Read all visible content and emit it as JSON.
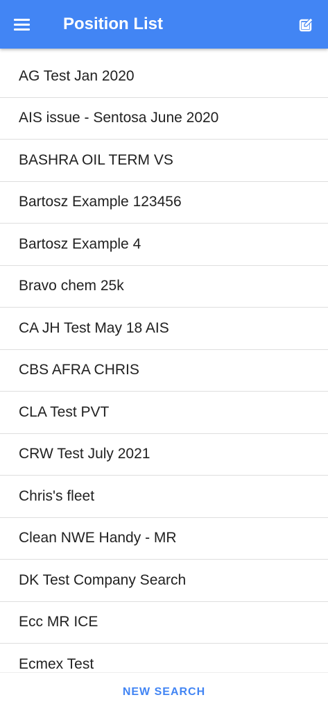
{
  "header": {
    "title": "Position List",
    "menu_icon": "hamburger-menu-icon",
    "edit_icon": "edit-pencil-icon",
    "background_color": "#4285f4"
  },
  "list": {
    "items": [
      "AG Test Jan 2020",
      "AIS issue - Sentosa June 2020",
      "BASHRA OIL TERM VS",
      "Bartosz Example 123456",
      "Bartosz Example 4",
      "Bravo chem 25k",
      "CA JH Test May 18 AIS",
      "CBS AFRA CHRIS",
      "CLA Test PVT",
      "CRW Test July 2021",
      "Chris's fleet",
      "Clean NWE Handy - MR",
      "DK Test Company Search",
      "Ecc MR ICE",
      "Ecmex Test"
    ]
  },
  "footer": {
    "new_search_label": "NEW SEARCH",
    "accent_color": "#4285f4"
  }
}
